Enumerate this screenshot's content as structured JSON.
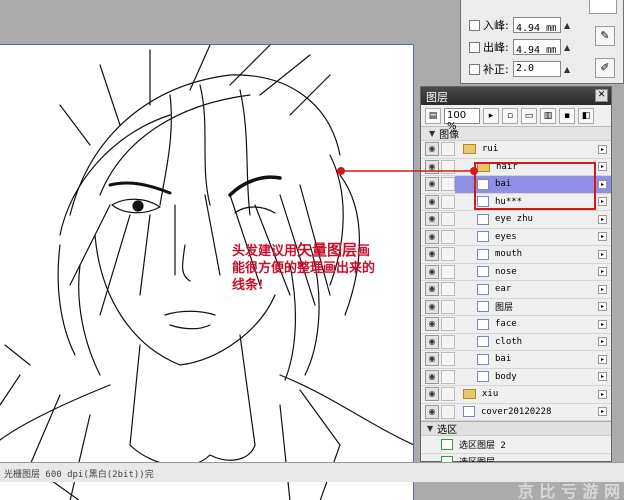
{
  "brush_settings": {
    "rows": [
      {
        "label": "入峰:",
        "value": "4.94 ㎜"
      },
      {
        "label": "出峰:",
        "value": "4.94 ㎜"
      },
      {
        "label": "补正:",
        "value": "2.0"
      }
    ]
  },
  "annotation": {
    "line1_prefix": "头发建议用",
    "line1_emph": "矢量图层",
    "line1_suffix": "画",
    "line2": "能很方便的整理画出来的",
    "line3": "线条!"
  },
  "layer_panel": {
    "title": "图层",
    "zoom": "100 %",
    "group_label": "图像",
    "layers": [
      {
        "name": "rui",
        "type": "folder",
        "depth": 0
      },
      {
        "name": "hair",
        "type": "folder",
        "depth": 1
      },
      {
        "name": "bai",
        "type": "layer",
        "depth": 1,
        "selected": true
      },
      {
        "name": "hu***",
        "type": "layer",
        "depth": 1
      },
      {
        "name": "eye zhu",
        "type": "layer",
        "depth": 1
      },
      {
        "name": "eyes",
        "type": "layer",
        "depth": 1
      },
      {
        "name": "mouth",
        "type": "layer",
        "depth": 1
      },
      {
        "name": "nose",
        "type": "layer",
        "depth": 1
      },
      {
        "name": "ear",
        "type": "layer",
        "depth": 1
      },
      {
        "name": "图层",
        "type": "layer",
        "depth": 1
      },
      {
        "name": "face",
        "type": "layer",
        "depth": 1
      },
      {
        "name": "cloth",
        "type": "layer",
        "depth": 1
      },
      {
        "name": "bai",
        "type": "layer",
        "depth": 1
      },
      {
        "name": "body",
        "type": "layer",
        "depth": 1
      },
      {
        "name": "xiu",
        "type": "folder",
        "depth": 0
      },
      {
        "name": "cover20120228",
        "type": "layer",
        "depth": 0
      }
    ],
    "section_label": "选区",
    "selection_layers": [
      {
        "name": "选区图层 2"
      },
      {
        "name": "选区图层"
      }
    ]
  },
  "status_bar": {
    "text": "光栅图层 600 dpi(黑白(2bit))完"
  },
  "watermark": {
    "text": "京 比 亏 游 网"
  },
  "colors": {
    "highlight_red": "#d11a1a",
    "selected_row": "#8f8fe6",
    "annotation_red": "#c8102e"
  }
}
